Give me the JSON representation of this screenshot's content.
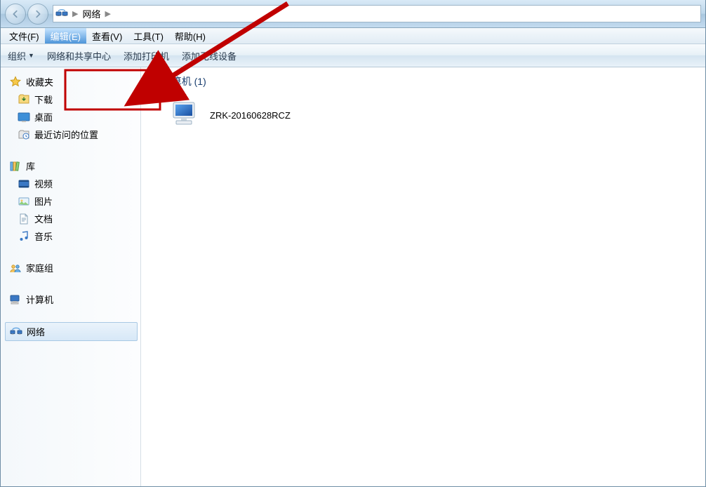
{
  "nav": {
    "breadcrumb": {
      "root_icon": "network-icon",
      "segments": [
        "网络"
      ]
    }
  },
  "menubar": {
    "items": [
      {
        "label": "文件(F)"
      },
      {
        "label": "编辑(E)",
        "selected": true
      },
      {
        "label": "查看(V)"
      },
      {
        "label": "工具(T)"
      },
      {
        "label": "帮助(H)"
      }
    ]
  },
  "toolbar": {
    "organize_label": "组织",
    "items": [
      {
        "label": "网络和共享中心"
      },
      {
        "label": "添加打印机"
      },
      {
        "label": "添加无线设备"
      }
    ]
  },
  "sidebar": {
    "favorites": {
      "header": "收藏夹",
      "items": [
        {
          "icon": "downloads-icon",
          "label": "下载"
        },
        {
          "icon": "desktop-icon",
          "label": "桌面"
        },
        {
          "icon": "recent-icon",
          "label": "最近访问的位置"
        }
      ]
    },
    "libraries": {
      "header": "库",
      "items": [
        {
          "icon": "videos-icon",
          "label": "视频"
        },
        {
          "icon": "pictures-icon",
          "label": "图片"
        },
        {
          "icon": "documents-icon",
          "label": "文档"
        },
        {
          "icon": "music-icon",
          "label": "音乐"
        }
      ]
    },
    "homegroup": {
      "header": "家庭组"
    },
    "computer": {
      "header": "计算机"
    },
    "network": {
      "header": "网络",
      "active": true
    }
  },
  "content": {
    "group": {
      "title": "计算机",
      "count": 1
    },
    "items": [
      {
        "icon": "computer-item-icon",
        "label": "ZRK-20160628RCZ"
      }
    ]
  },
  "colors": {
    "link_blue": "#1a3e6f",
    "highlight_red": "#c00000"
  }
}
